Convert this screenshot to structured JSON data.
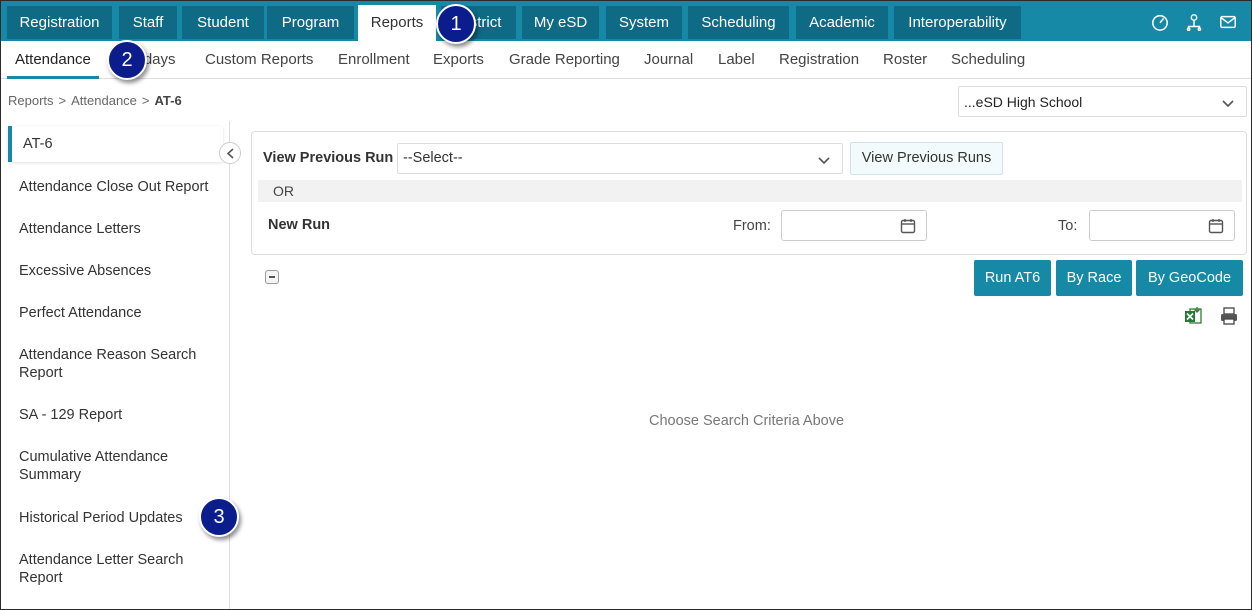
{
  "top_nav": {
    "tabs": [
      "Registration",
      "Staff",
      "Student",
      "Program",
      "Reports",
      "District",
      "My eSD",
      "System",
      "Scheduling",
      "Academic",
      "Interoperability"
    ],
    "active": "Reports",
    "icons": [
      "dashboard-icon",
      "user-tree-icon",
      "mail-icon"
    ]
  },
  "sub_nav": {
    "items": [
      "Attendance",
      "Birthdays",
      "Custom Reports",
      "Enrollment",
      "Exports",
      "Grade Reporting",
      "Journal",
      "Label",
      "Registration",
      "Roster",
      "Scheduling"
    ],
    "active": "Attendance"
  },
  "breadcrumb": {
    "parts": [
      "Reports",
      "Attendance"
    ],
    "current": "AT-6"
  },
  "school_select": {
    "value": "...eSD High School"
  },
  "sidebar": {
    "items": [
      "AT-6",
      "Attendance Close Out Report",
      "Attendance Letters",
      "Excessive Absences",
      "Perfect Attendance",
      "Attendance Reason Search Report",
      "SA - 129 Report",
      "Cumulative Attendance Summary",
      "Historical Period Updates",
      "Attendance Letter Search Report"
    ],
    "active": "AT-6"
  },
  "form": {
    "view_previous_label": "View Previous Run",
    "select_value": "--Select--",
    "view_previous_button": "View Previous Runs",
    "or_label": "OR",
    "new_run_label": "New Run",
    "from_label": "From:",
    "to_label": "To:"
  },
  "actions": {
    "run_at6": "Run AT6",
    "by_race": "By Race",
    "by_geocode": "By GeoCode"
  },
  "empty_message": "Choose Search Criteria Above",
  "callouts": [
    "1",
    "2",
    "3"
  ],
  "colors": {
    "primary": "#1589a6",
    "tab_dark": "#0f6a86",
    "callout": "#0b1c8c"
  }
}
